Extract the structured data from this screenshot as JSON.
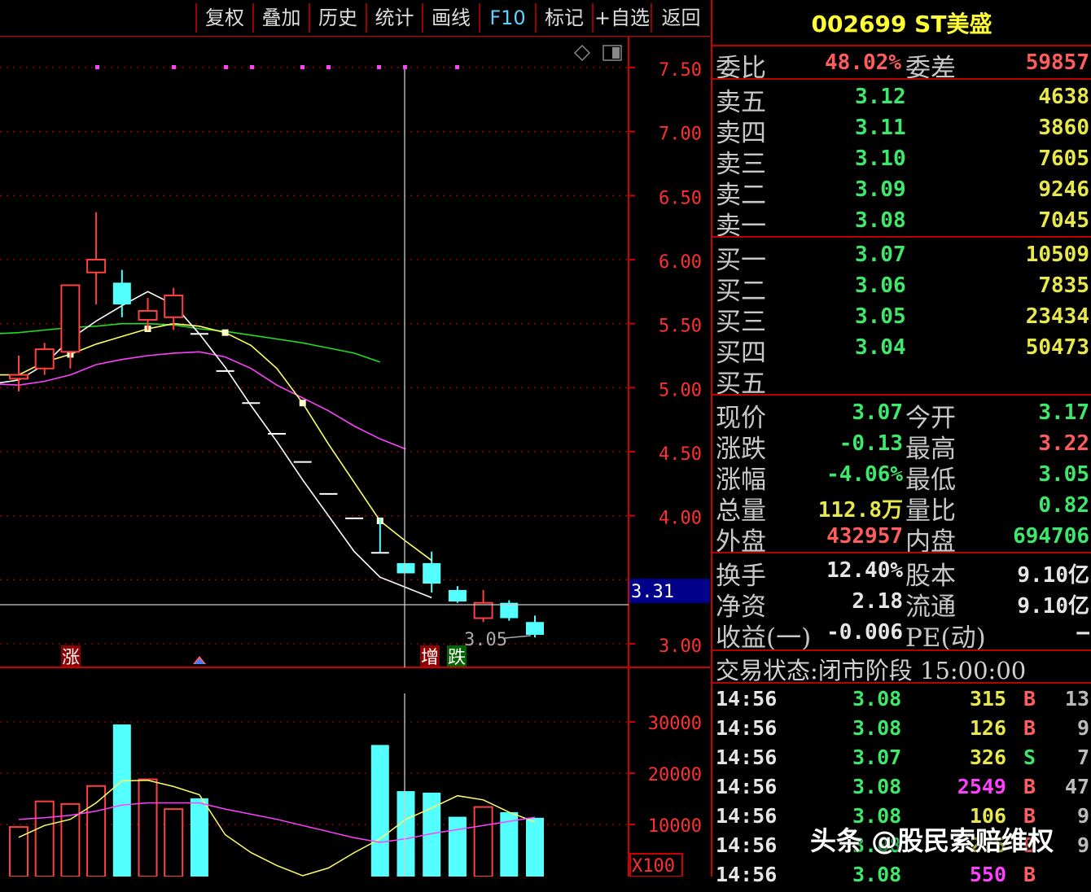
{
  "toolbar": {
    "buttons": [
      "复权",
      "叠加",
      "历史",
      "统计",
      "画线",
      "F10",
      "标记",
      "+自选",
      "返回"
    ]
  },
  "stock": {
    "code_name": "002699 ST美盛"
  },
  "chart_data": {
    "type": "candlestick",
    "price_axis": {
      "ticks": [
        "7.50",
        "7.00",
        "6.50",
        "6.00",
        "5.50",
        "5.00",
        "4.50",
        "4.00",
        "3.00"
      ],
      "ylim": [
        2.9,
        7.6
      ],
      "cursor_value": "3.31"
    },
    "low_label": "3.05",
    "candles": [
      {
        "o": 5.07,
        "h": 5.25,
        "l": 4.97,
        "c": 5.1,
        "up": true
      },
      {
        "o": 5.15,
        "h": 5.35,
        "l": 5.1,
        "c": 5.3,
        "up": true
      },
      {
        "o": 5.28,
        "h": 5.8,
        "l": 5.15,
        "c": 5.8,
        "up": true
      },
      {
        "o": 5.9,
        "h": 6.37,
        "l": 5.65,
        "c": 6.0,
        "up": true
      },
      {
        "o": 5.82,
        "h": 5.92,
        "l": 5.55,
        "c": 5.65,
        "up": false
      },
      {
        "o": 5.53,
        "h": 5.7,
        "l": 5.45,
        "c": 5.6,
        "up": true
      },
      {
        "o": 5.55,
        "h": 5.78,
        "l": 5.45,
        "c": 5.72,
        "up": true
      },
      {
        "o": 5.42,
        "h": 5.42,
        "l": 5.42,
        "c": 5.42,
        "up": false
      },
      {
        "o": 5.13,
        "h": 5.13,
        "l": 5.13,
        "c": 5.13,
        "up": false
      },
      {
        "o": 4.88,
        "h": 4.88,
        "l": 4.88,
        "c": 4.88,
        "up": false
      },
      {
        "o": 4.64,
        "h": 4.64,
        "l": 4.64,
        "c": 4.64,
        "up": false
      },
      {
        "o": 4.42,
        "h": 4.42,
        "l": 4.42,
        "c": 4.42,
        "up": false
      },
      {
        "o": 4.17,
        "h": 4.17,
        "l": 4.17,
        "c": 4.17,
        "up": false
      },
      {
        "o": 3.98,
        "h": 3.98,
        "l": 3.98,
        "c": 3.98,
        "up": false
      },
      {
        "o": 3.71,
        "h": 3.98,
        "l": 3.71,
        "c": 3.71,
        "up": false
      },
      {
        "o": 3.63,
        "h": 3.63,
        "l": 3.55,
        "c": 3.55,
        "up": false
      },
      {
        "o": 3.63,
        "h": 3.72,
        "l": 3.4,
        "c": 3.47,
        "up": false
      },
      {
        "o": 3.42,
        "h": 3.45,
        "l": 3.32,
        "c": 3.33,
        "up": false
      },
      {
        "o": 3.2,
        "h": 3.42,
        "l": 3.17,
        "c": 3.32,
        "up": true
      },
      {
        "o": 3.32,
        "h": 3.34,
        "l": 3.18,
        "c": 3.2,
        "up": false
      },
      {
        "o": 3.17,
        "h": 3.22,
        "l": 3.05,
        "c": 3.07,
        "up": false
      }
    ],
    "ma_white": [
      5.03,
      5.06,
      5.18,
      5.38,
      5.52,
      5.64,
      5.75,
      5.65,
      5.42,
      5.16,
      4.86,
      4.58,
      4.28,
      4.0,
      3.72,
      3.52,
      3.44,
      3.36
    ],
    "ma_yellow": [
      5.1,
      5.1,
      5.2,
      5.26,
      5.34,
      5.4,
      5.46,
      5.5,
      5.48,
      5.43,
      5.33,
      5.15,
      4.88,
      4.56,
      4.26,
      3.96,
      3.8,
      3.65
    ],
    "ma_magenta": [
      5.03,
      5.02,
      5.05,
      5.1,
      5.18,
      5.22,
      5.25,
      5.27,
      5.28,
      5.24,
      5.15,
      5.02,
      4.92,
      4.82,
      4.7,
      4.6,
      4.52
    ],
    "ma_green": [
      5.42,
      5.43,
      5.45,
      5.47,
      5.48,
      5.5,
      5.5,
      5.49,
      5.46,
      5.44,
      5.41,
      5.38,
      5.35,
      5.31,
      5.27,
      5.2
    ],
    "volume_axis": {
      "ticks": [
        "30000",
        "20000",
        "10000"
      ],
      "unit_label": "X100"
    },
    "volume": [
      9500,
      14500,
      14000,
      17500,
      29500,
      18800,
      13000,
      15100,
      0,
      0,
      0,
      0,
      0,
      0,
      25500,
      16500,
      16200,
      11500,
      13400,
      12400,
      11300
    ]
  },
  "markers": {
    "zhang": "涨",
    "zeng": "增",
    "die": "跌"
  },
  "quote": {
    "weibi_label": "委比",
    "weibi": "48.02%",
    "weicha_label": "委差",
    "weicha": "59857",
    "asks": [
      {
        "label": "卖五",
        "price": "3.12",
        "vol": "4638"
      },
      {
        "label": "卖四",
        "price": "3.11",
        "vol": "3860"
      },
      {
        "label": "卖三",
        "price": "3.10",
        "vol": "7605"
      },
      {
        "label": "卖二",
        "price": "3.09",
        "vol": "9246"
      },
      {
        "label": "卖一",
        "price": "3.08",
        "vol": "7045"
      }
    ],
    "bids": [
      {
        "label": "买一",
        "price": "3.07",
        "vol": "10509"
      },
      {
        "label": "买二",
        "price": "3.06",
        "vol": "7835"
      },
      {
        "label": "买三",
        "price": "3.05",
        "vol": "23434"
      },
      {
        "label": "买四",
        "price": "3.04",
        "vol": "50473"
      },
      {
        "label": "买五",
        "price": "",
        "vol": ""
      }
    ],
    "stats1": [
      {
        "l1": "现价",
        "v1": "3.07",
        "c1": "green",
        "l2": "今开",
        "v2": "3.17",
        "c2": "green"
      },
      {
        "l1": "涨跌",
        "v1": "-0.13",
        "c1": "green",
        "l2": "最高",
        "v2": "3.22",
        "c2": "red"
      },
      {
        "l1": "涨幅",
        "v1": "-4.06%",
        "c1": "green",
        "l2": "最低",
        "v2": "3.05",
        "c2": "green"
      },
      {
        "l1": "总量",
        "v1": "112.8万",
        "c1": "yellow",
        "l2": "量比",
        "v2": "0.82",
        "c2": "green"
      },
      {
        "l1": "外盘",
        "v1": "432957",
        "c1": "red",
        "l2": "内盘",
        "v2": "694706",
        "c2": "green"
      }
    ],
    "stats2": [
      {
        "l1": "换手",
        "v1": "12.40%",
        "l2": "股本",
        "v2": "9.10亿"
      },
      {
        "l1": "净资",
        "v1": "2.18",
        "l2": "流通",
        "v2": "9.10亿"
      },
      {
        "l1": "收益(一)",
        "v1": "-0.006",
        "l2": "PE(动)",
        "v2": "—"
      }
    ],
    "trade_status": "交易状态:闭市阶段 15:00:00"
  },
  "ticks": [
    {
      "time": "14:56",
      "price": "3.08",
      "vol": "315",
      "side": "B",
      "n": "13",
      "vc": "yellow"
    },
    {
      "time": "14:56",
      "price": "3.08",
      "vol": "126",
      "side": "B",
      "n": "9",
      "vc": "yellow"
    },
    {
      "time": "14:56",
      "price": "3.07",
      "vol": "326",
      "side": "S",
      "n": "7",
      "vc": "yellow"
    },
    {
      "time": "14:56",
      "price": "3.08",
      "vol": "2549",
      "side": "B",
      "n": "47",
      "vc": "magenta"
    },
    {
      "time": "14:56",
      "price": "3.08",
      "vol": "106",
      "side": "B",
      "n": "9",
      "vc": "yellow"
    },
    {
      "time": "14:56",
      "price": "3.08",
      "vol": "275",
      "side": "B",
      "n": "9",
      "vc": "yellow"
    },
    {
      "time": "14:56",
      "price": "3.08",
      "vol": "550",
      "side": "B",
      "n": "",
      "vc": "magenta"
    }
  ],
  "watermark": "头条 @股民索赔维权",
  "colors": {
    "up": "#ff4040",
    "down": "#54ffff",
    "ma_white": "#ffffff",
    "ma_yellow": "#ffff66",
    "ma_magenta": "#ff40ff",
    "ma_green": "#22dd22",
    "grid": "#b00000"
  }
}
